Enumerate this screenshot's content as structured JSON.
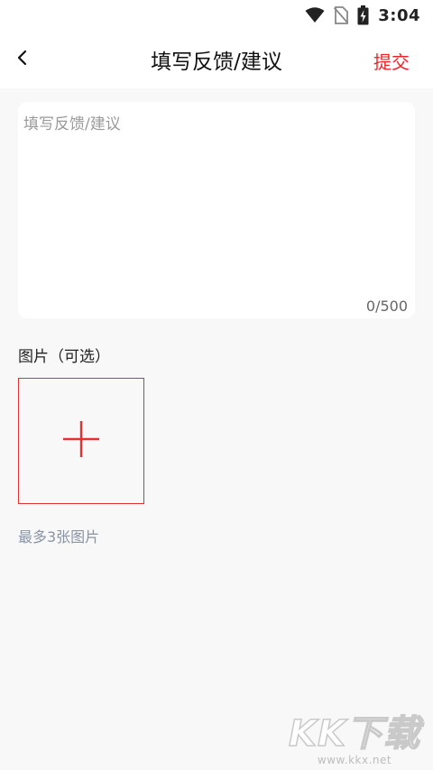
{
  "status_bar": {
    "time": "3:04",
    "icons": [
      "wifi-icon",
      "no-sim-icon",
      "battery-charging-icon"
    ]
  },
  "header": {
    "title": "填写反馈/建议",
    "back_icon": "chevron-left-icon",
    "submit_label": "提交"
  },
  "feedback": {
    "placeholder": "填写反馈/建议",
    "value": "",
    "counter": "0/500"
  },
  "images": {
    "section_label": "图片（可选）",
    "add_icon": "plus-icon",
    "hint": "最多3张图片"
  },
  "watermark": {
    "logo": "KK下载",
    "url": "www.kkx.net"
  },
  "colors": {
    "accent": "#e8262a",
    "background": "#f8f8f8",
    "hint_text": "#8a95a3"
  }
}
